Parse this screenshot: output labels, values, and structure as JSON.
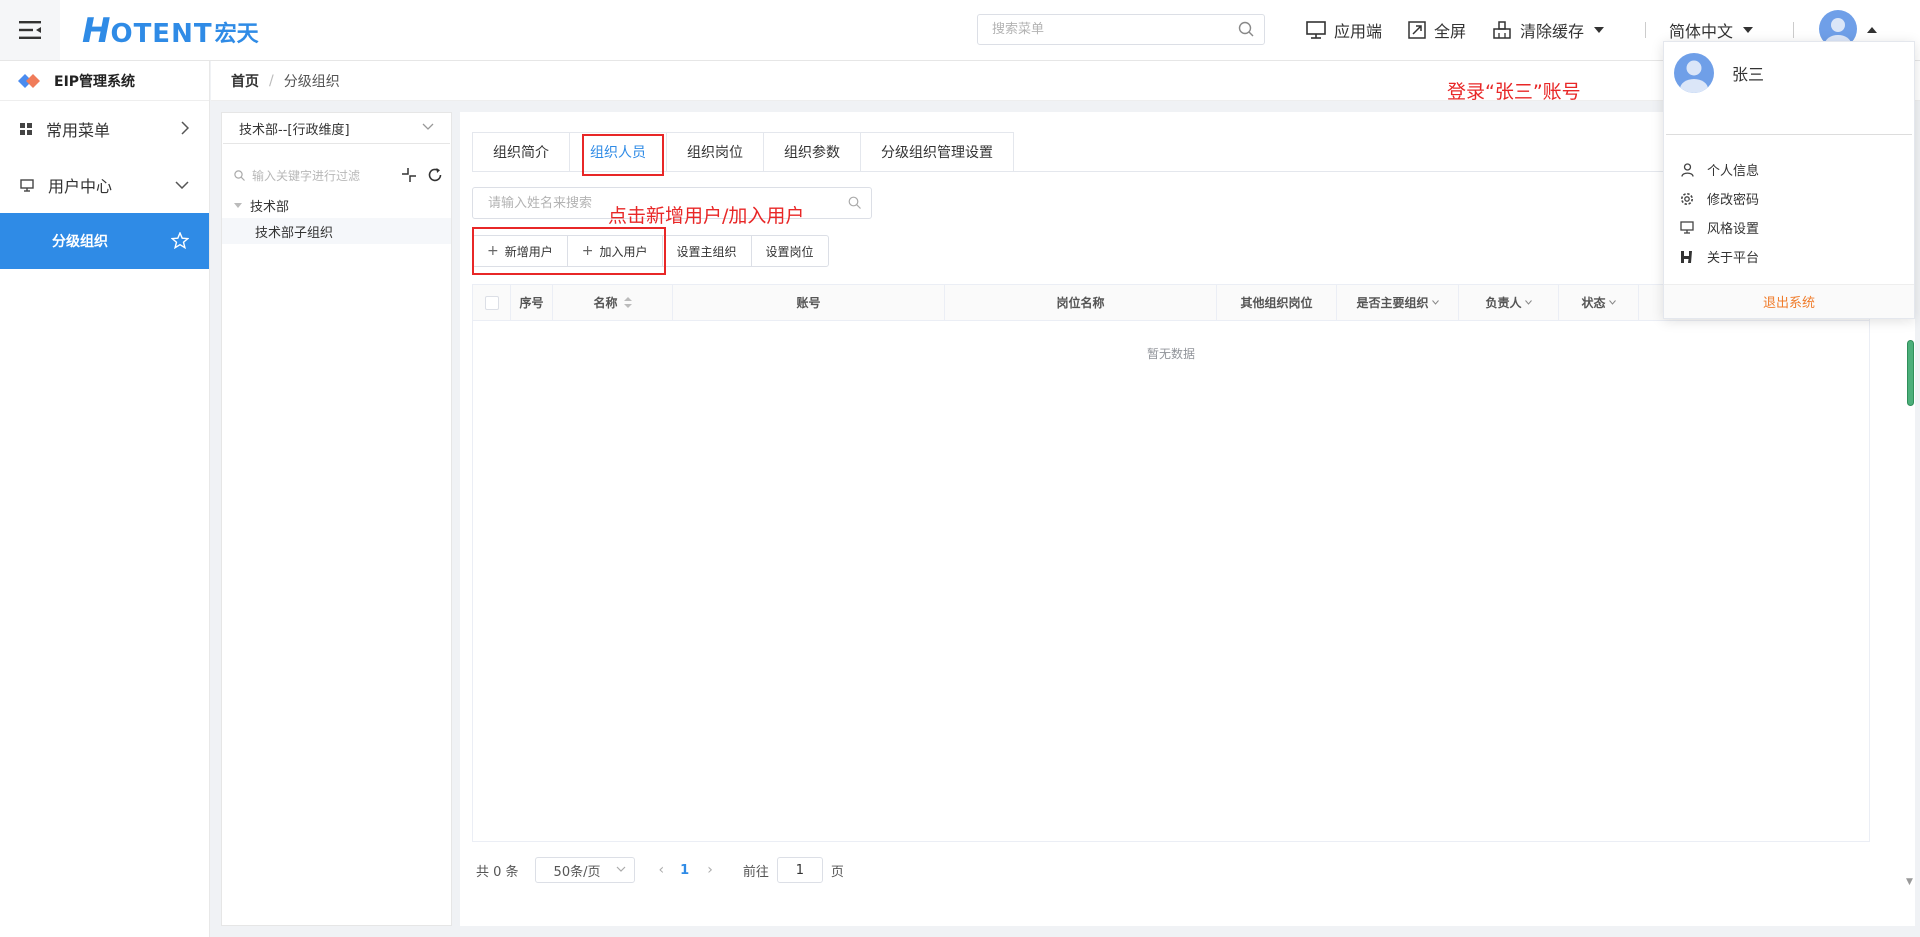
{
  "header": {
    "logo_main": "H",
    "logo_rest": "OTENT",
    "logo_cn": "宏天",
    "search_placeholder": "搜索菜单",
    "app_label": "应用端",
    "fullscreen_label": "全屏",
    "clear_cache_label": "清除缓存",
    "language_label": "简体中文"
  },
  "sidebar": {
    "system_title": "EIP管理系统",
    "items": [
      {
        "label": "常用菜单"
      },
      {
        "label": "用户中心"
      }
    ],
    "active_item": "分级组织"
  },
  "breadcrumb": {
    "home": "首页",
    "separator": "/",
    "current": "分级组织"
  },
  "tree": {
    "org_select": "技术部--[行政维度]",
    "filter_placeholder": "输入关键字进行过滤",
    "root_node": "技术部",
    "child_node": "技术部子组织"
  },
  "tabs": [
    "组织简介",
    "组织人员",
    "组织岗位",
    "组织参数",
    "分级组织管理设置"
  ],
  "active_tab_index": 1,
  "name_search_placeholder": "请输入姓名来搜索",
  "buttons": {
    "add_user": "新增用户",
    "join_user": "加入用户",
    "set_main_org": "设置主组织",
    "set_post": "设置岗位"
  },
  "table": {
    "columns": [
      "序号",
      "名称",
      "账号",
      "岗位名称",
      "其他组织岗位",
      "是否主要组织",
      "负责人",
      "状态"
    ],
    "empty_text": "暂无数据"
  },
  "pagination": {
    "total_text": "共 0 条",
    "page_size": "50条/页",
    "current_page": "1",
    "goto_label": "前往",
    "goto_value": "1",
    "page_unit": "页"
  },
  "annotations": {
    "login_note": "登录“张三”账号",
    "click_note": "点击新增用户/加入用户"
  },
  "user_menu": {
    "username": "张三",
    "items": [
      "个人信息",
      "修改密码",
      "风格设置",
      "关于平台"
    ],
    "logout": "退出系统"
  },
  "colors": {
    "primary": "#2f8be6",
    "annotation_red": "#e82727",
    "logout_orange": "#f07c2b"
  }
}
